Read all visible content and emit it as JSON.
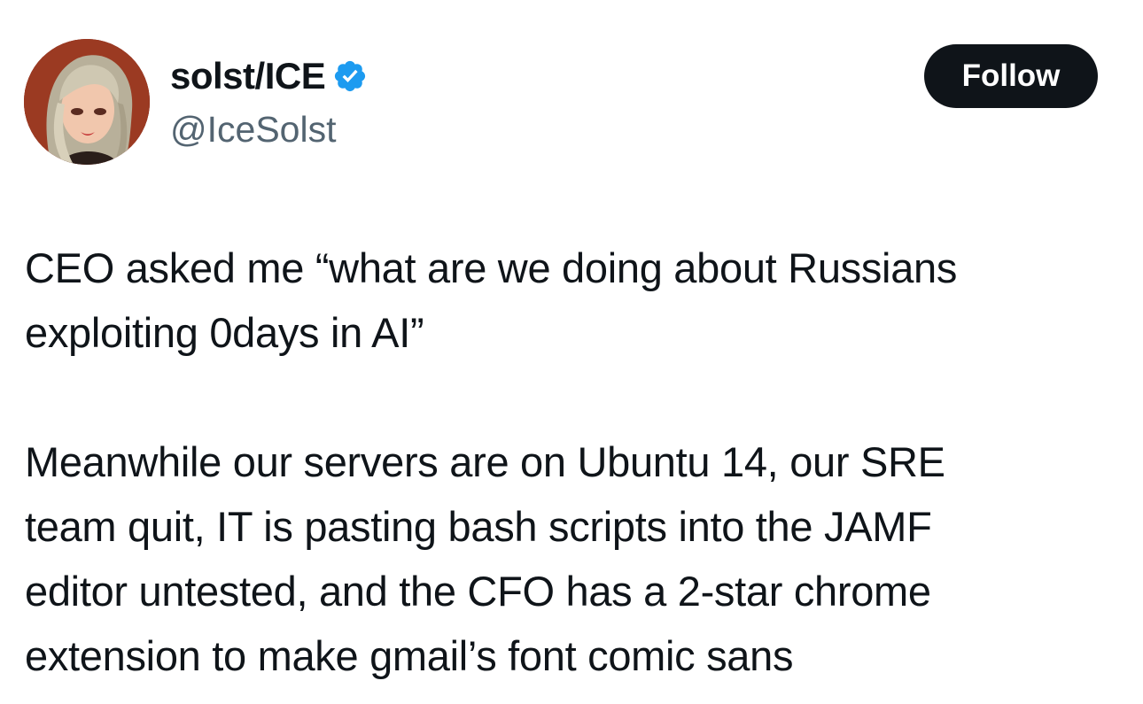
{
  "author": {
    "display_name": "solst/ICE",
    "handle": "@IceSolst",
    "verified": true,
    "verified_icon": "verified-badge-icon",
    "avatar_icon": "avatar-illustration"
  },
  "follow_button": {
    "label": "Follow"
  },
  "tweet": {
    "paragraphs": [
      "CEO asked me “what are we doing about Russians\nexploiting 0days in AI”",
      "Meanwhile our servers are on Ubuntu 14, our SRE\nteam quit, IT is pasting bash scripts into the JAMF\neditor untested, and the CFO has a 2-star chrome\nextension to make gmail’s font comic sans"
    ]
  },
  "colors": {
    "text": "#0f1419",
    "secondary": "#536471",
    "verified_blue": "#1d9bf0",
    "button_bg": "#0f1419",
    "button_text": "#ffffff"
  }
}
